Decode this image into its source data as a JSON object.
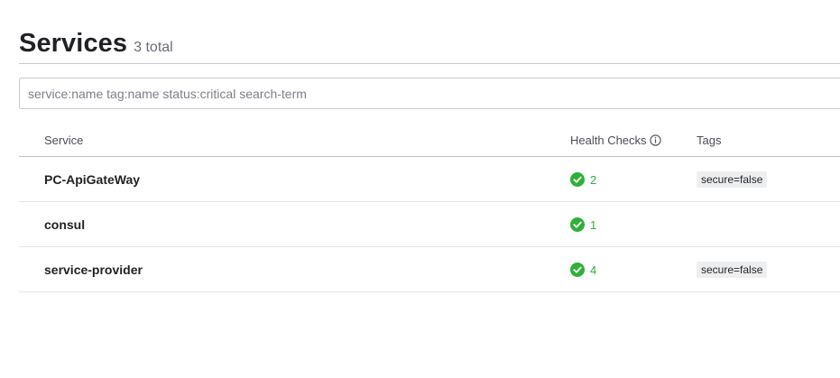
{
  "header": {
    "title": "Services",
    "count": "3 total"
  },
  "search": {
    "placeholder": "service:name tag:name status:critical search-term",
    "value": ""
  },
  "table": {
    "columns": {
      "service": "Service",
      "health": "Health Checks",
      "tags": "Tags"
    },
    "rows": [
      {
        "name": "PC-ApiGateWay",
        "health_count": "2",
        "health_status": "passing",
        "tags": [
          "secure=false"
        ]
      },
      {
        "name": "consul",
        "health_count": "1",
        "health_status": "passing",
        "tags": []
      },
      {
        "name": "service-provider",
        "health_count": "4",
        "health_status": "passing",
        "tags": [
          "secure=false"
        ]
      }
    ]
  },
  "icons": {
    "health_check": "check-circle-icon",
    "health_info": "info-icon"
  },
  "colors": {
    "passing": "#2eb039",
    "tag_background": "#eceef0"
  }
}
